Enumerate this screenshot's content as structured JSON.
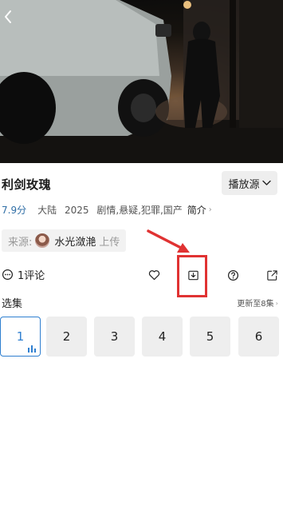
{
  "header": {
    "back_icon": "chevron-left-icon"
  },
  "show": {
    "title": "利剑玫瑰",
    "source_label": "播放源",
    "score": "7.9分",
    "region": "大陆",
    "year": "2025",
    "genres": "剧情,悬疑,犯罪,国产",
    "intro_label": "简介"
  },
  "uploader": {
    "prefix": "来源:",
    "name": "水光潋滟",
    "suffix": "上传"
  },
  "actions": {
    "comments_label": "1评论",
    "icons": [
      "comment-icon",
      "heart-icon",
      "download-icon",
      "help-icon",
      "share-icon"
    ]
  },
  "episodes": {
    "heading": "选集",
    "update_label": "更新至8集",
    "items": [
      "1",
      "2",
      "3",
      "4",
      "5",
      "6"
    ],
    "selected": "1"
  },
  "colors": {
    "accent": "#2f7fd0",
    "score": "#2f6ea6",
    "annotation": "#e03232"
  }
}
